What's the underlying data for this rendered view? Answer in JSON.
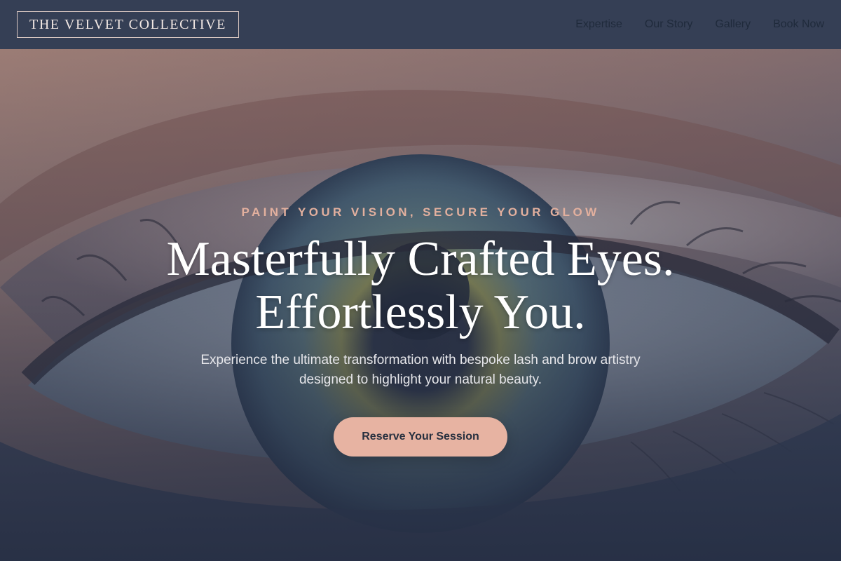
{
  "header": {
    "brand": "THE VELVET COLLECTIVE",
    "nav": [
      {
        "label": "Expertise"
      },
      {
        "label": "Our Story"
      },
      {
        "label": "Gallery"
      },
      {
        "label": "Book Now"
      }
    ]
  },
  "hero": {
    "eyebrow": "PAINT YOUR VISION, SECURE YOUR GLOW",
    "headline_line1": "Masterfully Crafted Eyes.",
    "headline_line2": "Effortlessly You.",
    "description": "Experience the ultimate transformation with bespoke lash and brow artistry designed to highlight your natural beauty.",
    "cta_label": "Reserve Your Session",
    "background_image": "close-up-eye-photo"
  },
  "colors": {
    "header_bg": "#353f55",
    "accent": "#e7b3a2",
    "eyebrow": "#e3b09e",
    "headline": "#ffffff",
    "nav_text": "#1f2a3b",
    "hero_overlay": "#2e3a52"
  }
}
